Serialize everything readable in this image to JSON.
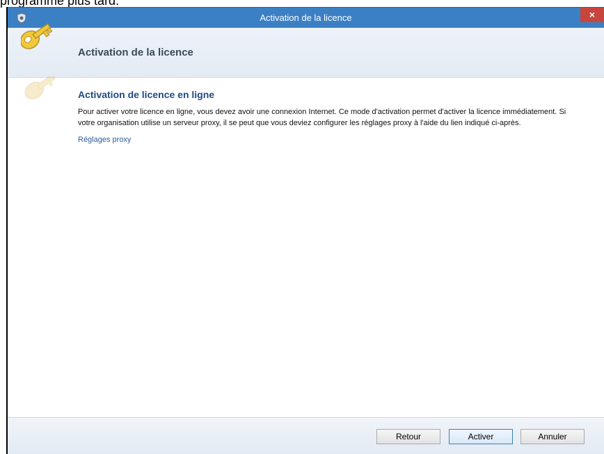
{
  "document": {
    "snippet": "programme plus tard."
  },
  "window": {
    "title": "Activation de la licence",
    "close_label": "×"
  },
  "header": {
    "title": "Activation de la licence"
  },
  "content": {
    "section_title": "Activation de licence en ligne",
    "description": "Pour activer votre licence en ligne, vous devez avoir une connexion Internet. Ce mode d'activation permet d'activer la licence immédiatement. Si votre organisation utilise un serveur proxy, il se peut que vous deviez configurer les réglages proxy à l'aide du lien indiqué ci-après.",
    "proxy_link": "Réglages proxy"
  },
  "footer": {
    "buttons": [
      {
        "label": "Retour"
      },
      {
        "label": "Activer"
      },
      {
        "label": "Annuler"
      }
    ]
  },
  "icons": {
    "app": "app-icon",
    "key": "key-icon"
  },
  "colors": {
    "titlebar": "#3b80c4",
    "close": "#c7453c",
    "section_title": "#1f4a82",
    "link": "#2d5d9a",
    "key_gold": "#f0c93a"
  }
}
